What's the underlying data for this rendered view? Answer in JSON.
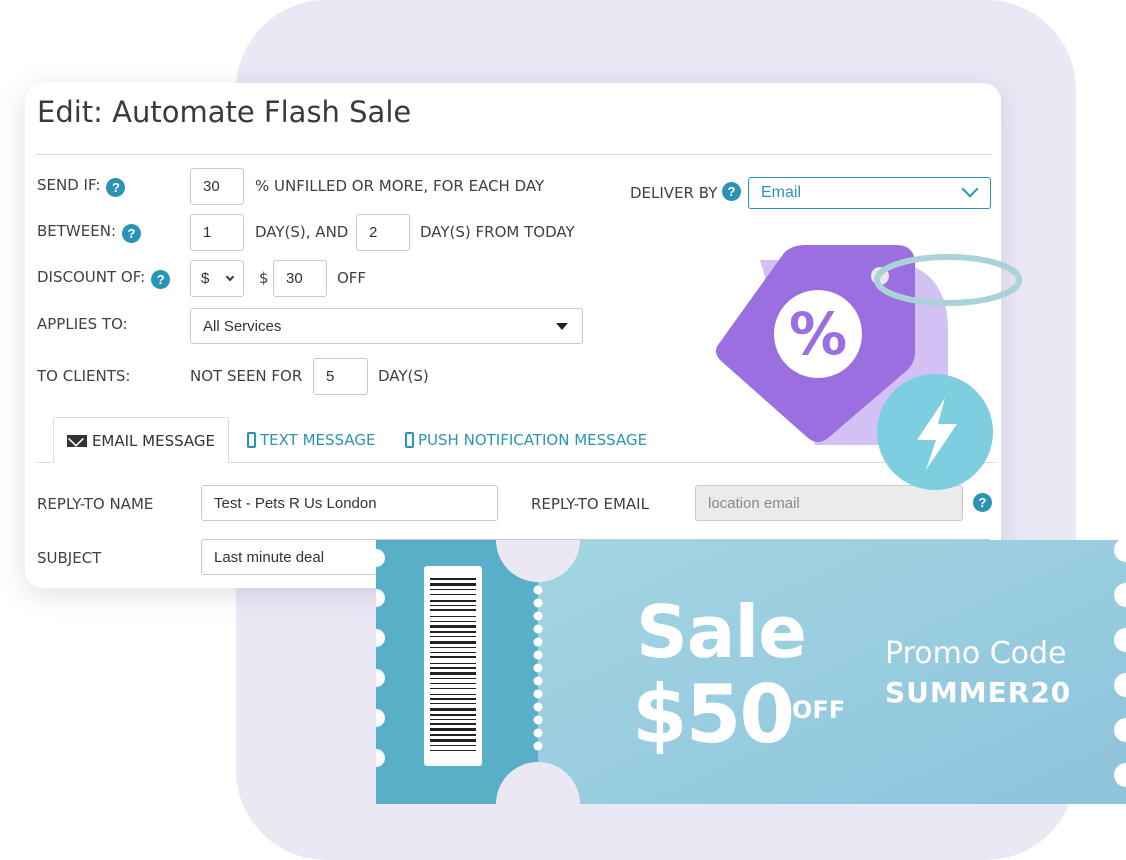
{
  "form": {
    "title": "Edit: Automate Flash Sale",
    "send_if": {
      "label": "SEND IF:",
      "value": "30",
      "suffix": "% UNFILLED OR MORE, FOR EACH DAY"
    },
    "deliver_by": {
      "label": "DELIVER BY",
      "value": "Email"
    },
    "between": {
      "label": "BETWEEN:",
      "from_value": "1",
      "middle": "DAY(S), AND",
      "to_value": "2",
      "suffix": "DAY(S) FROM TODAY"
    },
    "discount": {
      "label": "DISCOUNT OF:",
      "currency_select": "$",
      "currency_symbol": "$",
      "value": "30",
      "suffix": "OFF"
    },
    "applies_to": {
      "label": "APPLIES TO:",
      "value": "All Services"
    },
    "to_clients": {
      "label": "TO CLIENTS:",
      "prefix": "NOT SEEN FOR",
      "value": "5",
      "suffix": "DAY(S)"
    },
    "tabs": [
      {
        "label": "EMAIL MESSAGE",
        "active": true
      },
      {
        "label": "TEXT MESSAGE",
        "active": false
      },
      {
        "label": "PUSH NOTIFICATION MESSAGE",
        "active": false
      }
    ],
    "reply_to_name": {
      "label": "REPLY-TO NAME",
      "value": "Test - Pets R Us London"
    },
    "reply_to_email": {
      "label": "REPLY-TO EMAIL",
      "placeholder": "location email"
    },
    "subject": {
      "label": "SUBJECT",
      "value": "Last minute deal"
    },
    "help_glyph": "?"
  },
  "tag": {
    "symbol": "%"
  },
  "coupon": {
    "headline": "Sale",
    "amount": "$50",
    "amount_suffix": "OFF",
    "promo_label": "Promo Code",
    "promo_code": "SUMMER20"
  },
  "colors": {
    "accent": "#2a94b5",
    "background_blob": "#ebe8f6",
    "tag_purple": "#9b6fe0",
    "tag_lavender": "#d3c1f3",
    "bolt_circle": "#7dcfe0",
    "coupon_teal": "#5aafc8",
    "coupon_light": "#9fd3e0"
  }
}
